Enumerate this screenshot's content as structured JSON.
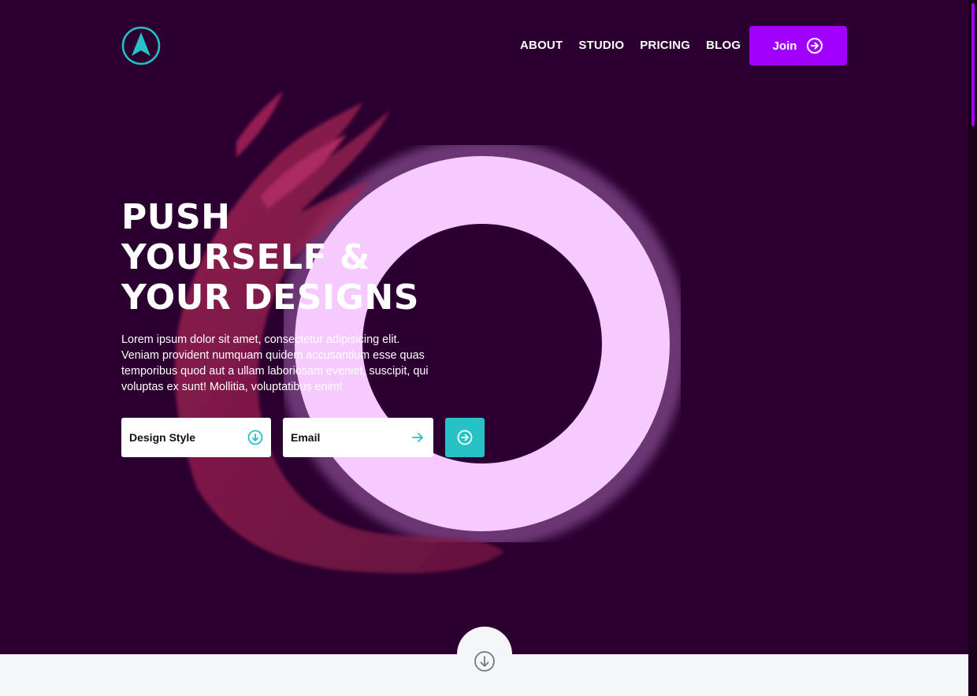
{
  "brand": {
    "logo_icon": "arrow-logo-icon",
    "accent_color": "#a100ff",
    "teal_color": "#26c2c5",
    "bg_color": "#2b0030"
  },
  "nav": {
    "items": [
      "ABOUT",
      "STUDIO",
      "PRICING",
      "BLOG"
    ],
    "join_label": "Join",
    "join_icon": "arrow-right-circle-icon"
  },
  "hero": {
    "headline_lines": [
      "PUSH",
      "YOURSELF &",
      "YOUR DESIGNS"
    ],
    "lead": "Lorem ipsum dolor sit amet, consectetur adipisicing elit. Veniam provident numquam quidem accusantium esse quas temporibus quod aut a ullam laboriosam eveniet, suscipit, qui voluptas ex sunt! Mollitia, voluptatibus enim!"
  },
  "form": {
    "design_style_label": "Design Style",
    "design_style_icon": "arrow-down-circle-icon",
    "email_label": "Email",
    "email_icon": "arrow-right-icon",
    "submit_icon": "arrow-right-circle-icon"
  },
  "scroll": {
    "icon": "arrow-down-circle-icon"
  }
}
